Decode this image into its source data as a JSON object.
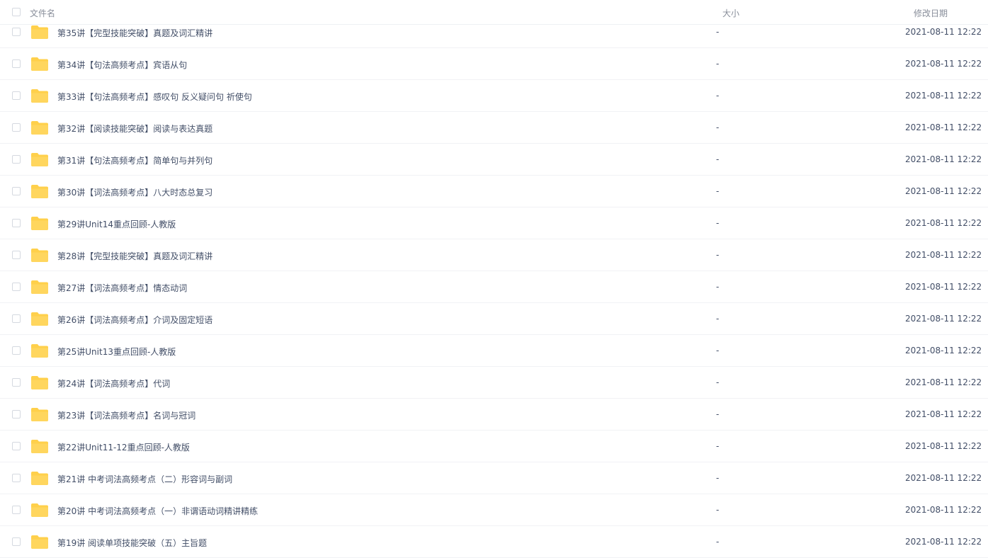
{
  "columns": {
    "name": "文件名",
    "size": "大小",
    "modified": "修改日期"
  },
  "folder_icon": "folder-icon",
  "folder_color": "#ffd04b",
  "files": [
    {
      "name": "第35讲【完型技能突破】真题及词汇精讲",
      "size": "-",
      "modified": "2021-08-11 12:22"
    },
    {
      "name": "第34讲【句法高频考点】宾语从句",
      "size": "-",
      "modified": "2021-08-11 12:22"
    },
    {
      "name": "第33讲【句法高频考点】感叹句 反义疑问句 祈使句",
      "size": "-",
      "modified": "2021-08-11 12:22"
    },
    {
      "name": "第32讲【阅读技能突破】阅读与表达真题",
      "size": "-",
      "modified": "2021-08-11 12:22"
    },
    {
      "name": "第31讲【句法高频考点】简单句与并列句",
      "size": "-",
      "modified": "2021-08-11 12:22"
    },
    {
      "name": "第30讲【词法高频考点】八大时态总复习",
      "size": "-",
      "modified": "2021-08-11 12:22"
    },
    {
      "name": "第29讲Unit14重点回顾-人教版",
      "size": "-",
      "modified": "2021-08-11 12:22"
    },
    {
      "name": "第28讲【完型技能突破】真题及词汇精讲",
      "size": "-",
      "modified": "2021-08-11 12:22"
    },
    {
      "name": "第27讲【词法高频考点】情态动词",
      "size": "-",
      "modified": "2021-08-11 12:22"
    },
    {
      "name": "第26讲【词法高频考点】介词及固定短语",
      "size": "-",
      "modified": "2021-08-11 12:22"
    },
    {
      "name": "第25讲Unit13重点回顾-人教版",
      "size": "-",
      "modified": "2021-08-11 12:22"
    },
    {
      "name": "第24讲【词法高频考点】代词",
      "size": "-",
      "modified": "2021-08-11 12:22"
    },
    {
      "name": "第23讲【词法高频考点】名词与冠词",
      "size": "-",
      "modified": "2021-08-11 12:22"
    },
    {
      "name": "第22讲Unit11-12重点回顾-人教版",
      "size": "-",
      "modified": "2021-08-11 12:22"
    },
    {
      "name": "第21讲 中考词法高频考点（二）形容词与副词",
      "size": "-",
      "modified": "2021-08-11 12:22"
    },
    {
      "name": "第20讲 中考词法高频考点（一）非谓语动词精讲精练",
      "size": "-",
      "modified": "2021-08-11 12:22"
    },
    {
      "name": "第19讲 阅读单项技能突破（五）主旨题",
      "size": "-",
      "modified": "2021-08-11 12:22"
    }
  ]
}
